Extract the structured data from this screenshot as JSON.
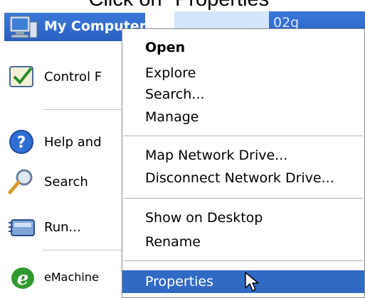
{
  "caption": "Click on \"Properties\"",
  "start_menu": {
    "my_computer_label": "My Computer",
    "my_computer_right_text": "02g",
    "items": [
      {
        "label": "Control F",
        "icon": "control-panel-icon"
      },
      {
        "label": "Help and",
        "icon": "help-icon"
      },
      {
        "label": "Search",
        "icon": "search-icon"
      },
      {
        "label": "Run...",
        "icon": "run-icon"
      },
      {
        "label": "eMachine",
        "icon": "emachines-icon"
      }
    ]
  },
  "context_menu": {
    "items": [
      {
        "label": "Open",
        "bold": true
      },
      {
        "label": "Explore"
      },
      {
        "label": "Search..."
      },
      {
        "label": "Manage"
      },
      {
        "label": "Map Network Drive..."
      },
      {
        "label": "Disconnect Network Drive..."
      },
      {
        "label": "Show on Desktop"
      },
      {
        "label": "Rename"
      },
      {
        "label": "Properties",
        "highlighted": true
      }
    ]
  },
  "colors": {
    "highlight": "#316ac5",
    "start_menu_blue": "#2a5fc0",
    "right_pane": "#d3e5fa"
  }
}
